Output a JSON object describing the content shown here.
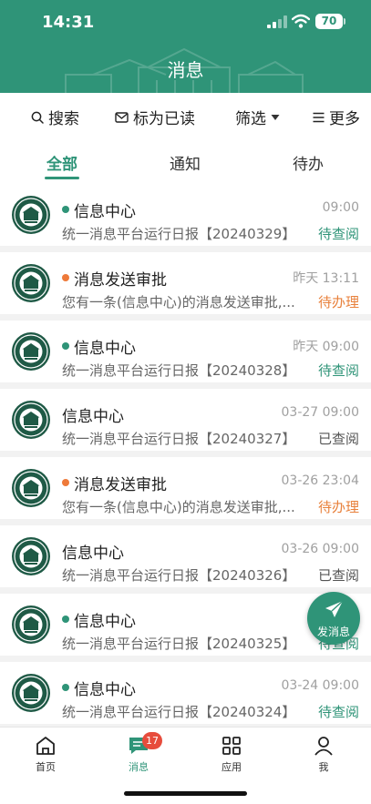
{
  "status_bar": {
    "time": "14:31",
    "battery": "70"
  },
  "header": {
    "title": "消息"
  },
  "actions": {
    "search": "搜索",
    "mark_read": "标为已读",
    "filter": "筛选",
    "more": "更多"
  },
  "tabs": [
    {
      "label": "全部"
    },
    {
      "label": "通知"
    },
    {
      "label": "待办"
    }
  ],
  "messages": [
    {
      "sender": "信息中心",
      "dot": "green",
      "time": "09:00",
      "summary": "统一消息平台运行日报【20240329】",
      "status": "待查阅",
      "status_color": "green"
    },
    {
      "sender": "消息发送审批",
      "dot": "orange",
      "time": "昨天 13:11",
      "summary": "您有一条(信息中心)的消息发送审批,...",
      "status": "待办理",
      "status_color": "orange"
    },
    {
      "sender": "信息中心",
      "dot": "green",
      "time": "昨天 09:00",
      "summary": "统一消息平台运行日报【20240328】",
      "status": "待查阅",
      "status_color": "green"
    },
    {
      "sender": "信息中心",
      "dot": "",
      "time": "03-27 09:00",
      "summary": "统一消息平台运行日报【20240327】",
      "status": "已查阅",
      "status_color": "gray"
    },
    {
      "sender": "消息发送审批",
      "dot": "orange",
      "time": "03-26 23:04",
      "summary": "您有一条(信息中心)的消息发送审批,...",
      "status": "待办理",
      "status_color": "orange"
    },
    {
      "sender": "信息中心",
      "dot": "",
      "time": "03-26 09:00",
      "summary": "统一消息平台运行日报【20240326】",
      "status": "已查阅",
      "status_color": "gray"
    },
    {
      "sender": "信息中心",
      "dot": "green",
      "time": "03-2",
      "summary": "统一消息平台运行日报【20240325】",
      "status": "待查阅",
      "status_color": "green"
    },
    {
      "sender": "信息中心",
      "dot": "green",
      "time": "03-24 09:00",
      "summary": "统一消息平台运行日报【20240324】",
      "status": "待查阅",
      "status_color": "green"
    }
  ],
  "fab": {
    "label": "发消息"
  },
  "bottom_nav": [
    {
      "label": "首页",
      "icon": "home-icon"
    },
    {
      "label": "消息",
      "icon": "message-icon",
      "badge": "17"
    },
    {
      "label": "应用",
      "icon": "apps-grid-icon"
    },
    {
      "label": "我",
      "icon": "user-icon"
    }
  ],
  "colors": {
    "primary": "#2f9478",
    "orange": "#e8813c",
    "badge": "#e74c3c"
  }
}
